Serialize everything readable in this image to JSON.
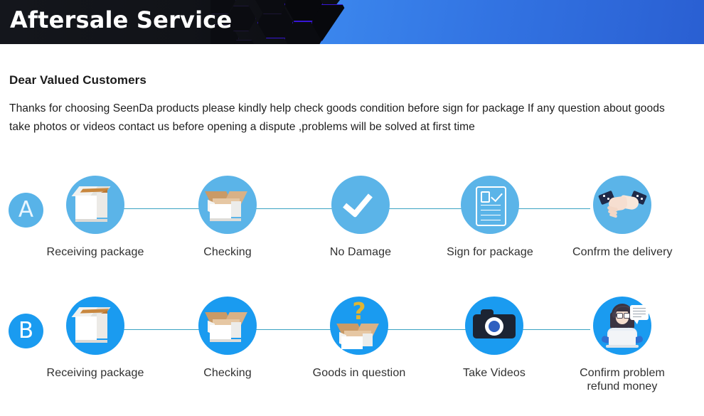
{
  "header": {
    "title": "Aftersale Service",
    "dark_bg": "#111318",
    "blue_start": "#49a8f7",
    "blue_end": "#2a5fd2",
    "hex_outline": "#3716d6"
  },
  "intro": {
    "greeting": "Dear Valued Customers",
    "body": "Thanks for choosing SeenDa products please kindly help check goods condition before sign for package If any question about goods take photos or videos contact us before opening a dispute ,problems will be solved at first time"
  },
  "flows": [
    {
      "badge": "A",
      "badge_color": "#58b3e8",
      "circle_color": "#5bb4e8",
      "connector_color": "#3ba3c2",
      "steps": [
        {
          "icon": "closed-package-box-icon",
          "label": "Receiving package"
        },
        {
          "icon": "open-box-icon",
          "label": "Checking"
        },
        {
          "icon": "checkmark-icon",
          "label": "No Damage"
        },
        {
          "icon": "signed-document-icon",
          "label": "Sign for package"
        },
        {
          "icon": "handshake-icon",
          "label": "Confrm the delivery"
        }
      ]
    },
    {
      "badge": "B",
      "badge_color": "#1a9bf0",
      "circle_color": "#1a9bf0",
      "connector_color": "#3ba3c2",
      "steps": [
        {
          "icon": "closed-package-box-icon",
          "label": "Receiving package"
        },
        {
          "icon": "open-box-icon",
          "label": "Checking"
        },
        {
          "icon": "question-box-icon",
          "label": "Goods in question"
        },
        {
          "icon": "camera-icon",
          "label": "Take Videos"
        },
        {
          "icon": "support-agent-icon",
          "label": "Confirm problem refund money"
        }
      ]
    }
  ]
}
